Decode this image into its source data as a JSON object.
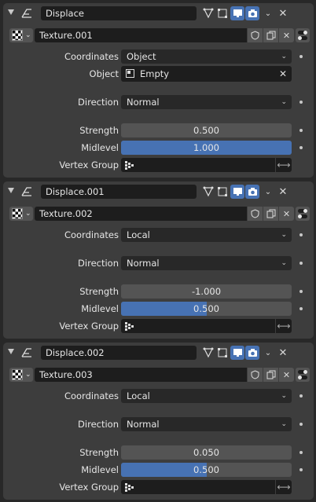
{
  "modifiers": [
    {
      "name": "Displace",
      "texture": "Texture.001",
      "coordinates_label": "Coordinates",
      "coordinates": "Object",
      "object_label": "Object",
      "object": "Empty",
      "direction_label": "Direction",
      "direction": "Normal",
      "strength_label": "Strength",
      "strength": "0.500",
      "midlevel_label": "Midlevel",
      "midlevel": "1.000",
      "midlevel_fill": 1.0,
      "vertex_group_label": "Vertex Group"
    },
    {
      "name": "Displace.001",
      "texture": "Texture.002",
      "coordinates_label": "Coordinates",
      "coordinates": "Local",
      "direction_label": "Direction",
      "direction": "Normal",
      "strength_label": "Strength",
      "strength": "-1.000",
      "midlevel_label": "Midlevel",
      "midlevel": "0.500",
      "midlevel_fill": 0.5,
      "vertex_group_label": "Vertex Group"
    },
    {
      "name": "Displace.002",
      "texture": "Texture.003",
      "coordinates_label": "Coordinates",
      "coordinates": "Local",
      "direction_label": "Direction",
      "direction": "Normal",
      "strength_label": "Strength",
      "strength": "0.050",
      "midlevel_label": "Midlevel",
      "midlevel": "0.500",
      "midlevel_fill": 0.5,
      "vertex_group_label": "Vertex Group"
    }
  ],
  "icons": {
    "expander": "chevron-down-icon",
    "modifier": "displace-modifier-icon",
    "editmode": "edit-mode-icon",
    "cage": "on-cage-icon",
    "realtime": "viewport-display-icon",
    "render": "render-camera-icon",
    "texture_preview": "checker-texture-icon",
    "fake_user": "shield-icon",
    "duplicate": "duplicate-icon",
    "unlink": "close-icon",
    "vertex_group": "vertex-group-icon",
    "invert": "invert-arrows-icon"
  },
  "colors": {
    "accent_blue": "#4772b3",
    "panel": "#3d3d3d",
    "background": "#282828"
  }
}
